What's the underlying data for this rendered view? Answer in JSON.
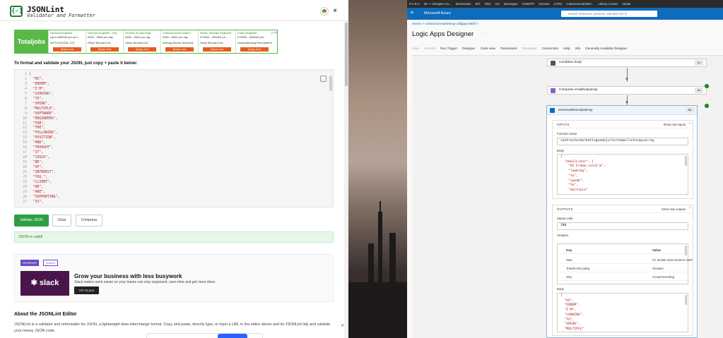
{
  "jsonlint": {
    "title": "JSONLint",
    "subtitle": "Validator and Formatter",
    "logo_mark": "{✓}",
    "intro": "To format and validate your JSON, just copy + paste it below:",
    "ad": {
      "logo": "Totaljobs",
      "cards": [
        {
          "title": "DevOps Engineer",
          "pay": "Up to £65000 per ann...",
          "company": "WITH DIGITAL LTD",
          "button": "Apply now"
        },
        {
          "title": "DevOps Engineer - Infr...",
          "pay": "£500 - £550 per day",
          "company": "Oliver Bernard Ltd",
          "button": "Apply now"
        },
        {
          "title": "SCADA In-Ops Engi...",
          "pay": "£550 - £600 per day",
          "company": "Oliver Bernard Ltd",
          "button": "Apply now"
        },
        {
          "title": "Contract Azure Data E...",
          "pay": "£500 - £600 per day",
          "company": "Iceburg Works Technical",
          "button": "Apply now"
        },
        {
          "title": "Senior DevOps Engineer",
          "pay": "£70000 - £90000 pe...",
          "company": "Oliver Bernard Ltd",
          "button": "Apply now"
        },
        {
          "title": "Cloud Engineer",
          "pay": "£75000 - £85000 per...",
          "company": "Understanding Recruitment...",
          "button": "Apply now"
        }
      ]
    },
    "editor": {
      "line_numbers": [
        "1",
        "2",
        "3",
        "4",
        "5",
        "6",
        "7",
        "8",
        "9",
        "10",
        "11",
        "12",
        "13",
        "14",
        "15",
        "16",
        "17",
        "18",
        "19",
        "20",
        "21",
        "22",
        "23",
        "24",
        "25",
        "26",
        "27"
      ],
      "lines": [
        "[",
        "  \"HI\",",
        "  \"ERDEM\",",
        "  \"I'M\",",
        "  \"LOOKING\",",
        "  \"TO\",",
        "  \"SPEAK\",",
        "  \"MULTIPLE\",",
        "  \"SOFTWARE\",",
        "  \"ENGINEERS\",",
        "  \"FOR\",",
        "  \"THE\",",
        "  \"FOLLOWING\",",
        "  \"POSITION\",",
        "  \"AND\",",
        "  \"THOUGHT\",",
        "  \"IT\",",
        "  \"COULD\",",
        "  \"BE\",",
        "  \"OF\",",
        "  \"INTEREST\",",
        "  \"YOU.\",",
        "  \"CLIENT\",",
        "  \"WE\",",
        "  \"ARE\",",
        "  \"SUPPORTING\",",
        "  \"IS\","
      ]
    },
    "buttons": {
      "validate": "Validate JSON",
      "clear": "Clear",
      "compress": "Compress"
    },
    "valid_message": "JSON is valid!",
    "slack_ad": {
      "sponsor": "SPONSOR",
      "tag": "SLACK",
      "logo": "✱ slack",
      "title": "Grow your business with less busywork",
      "desc": "Slack makes work easier so your teams can stay organized, save time and get more done.",
      "button": "TRY SLACK"
    },
    "about": {
      "title": "About the JSONLint Editor",
      "text": "JSONLint is a validator and reformatter for JSON, a lightweight data-interchange format. Copy and paste, directly type, or input a URL in the editor above and let JSONLint tidy and validate your messy JSON code."
    }
  },
  "azure": {
    "bookmarks": [
      "P.A.R.A",
      "30 ++ Designer Au...",
      "Bookmarks",
      "MIT",
      "DNA",
      "Ion",
      "Messages",
      "ChatGPT",
      "function",
      "CAPS",
      "contractormarketin...",
      "Library | Learn",
      "Adobe"
    ],
    "brand": "Microsoft Azure",
    "search_placeholder": "Search resources, services, and docs (G+/)",
    "breadcrumb": "Home  >  contractormarketing-callgap-distill  >",
    "title": "Logic Apps Designer",
    "toolbar": [
      "Save",
      "Discard",
      "Run Trigger",
      "Designer",
      "Code view",
      "Parameters",
      "Templates",
      "Connectors",
      "Help",
      "Info",
      "Generally Available Designer"
    ],
    "nodes": [
      {
        "label": "Condition body",
        "time": "0s"
      },
      {
        "label": "Compose emailbodyarray",
        "time": "0s"
      }
    ],
    "expanded": {
      "label": "turnemailintocapsarray",
      "time": "0s",
      "inputs": {
        "title": "INPUTS",
        "show": "Show raw inputs",
        "function_label": "Function name",
        "function_value": "contractormarketingnodejs/turnemailintocapsarray",
        "body_label": "Body",
        "body_lines": [
          "{",
          "  \"emailLines\": [",
          "    \"HI Erdem,\\n\\nI'm\",",
          "    \"looking\",",
          "    \"to\",",
          "    \"speak\",",
          "    \"to\",",
          "    \"multiple\""
        ]
      },
      "outputs": {
        "title": "OUTPUTS",
        "show": "Show raw outputs",
        "status_label": "Status code",
        "status_value": "200",
        "headers_label": "Headers",
        "headers_col_key": "Key",
        "headers_col_val": "Value",
        "headers": [
          {
            "k": "Date",
            "v": "Fri, 08 Mar 2024 16:29:11 GMT"
          },
          {
            "k": "Transfer-Encoding",
            "v": "chunked"
          },
          {
            "k": "Vary",
            "v": "Accept-Encoding"
          }
        ],
        "body_label": "Body",
        "body_lines": [
          "[",
          "  \"HI\",",
          "  \"ERDEM\",",
          "  \"I'M\",",
          "  \"LOOKING\",",
          "  \"TO\",",
          "  \"SPEAK\",",
          "  \"MULTIPLE\""
        ]
      }
    }
  }
}
